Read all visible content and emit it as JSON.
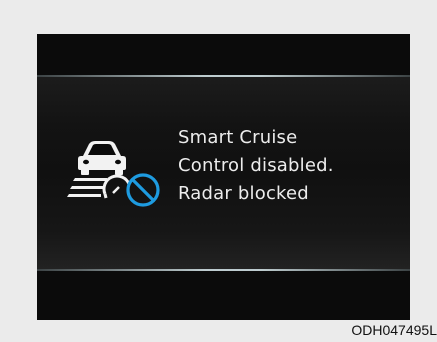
{
  "display": {
    "message_lines": [
      "Smart Cruise",
      "Control disabled.",
      "Radar blocked"
    ],
    "icon": "smart-cruise-radar-blocked-icon",
    "text_color": "#ececec",
    "accent_color": "#1e9be0"
  },
  "figure_code": "ODH047495L"
}
